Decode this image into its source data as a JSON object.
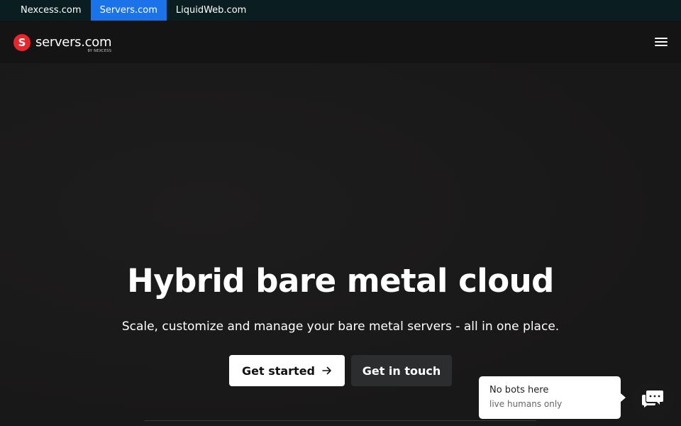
{
  "topbar": {
    "links": [
      {
        "label": "Nexcess.com"
      },
      {
        "label": "Servers.com"
      },
      {
        "label": "LiquidWeb.com"
      }
    ]
  },
  "header": {
    "logo_mark": "S",
    "logo_name": "servers.com",
    "logo_sub": "BY NEXCESS",
    "menu_icon": "hamburger-menu-icon"
  },
  "hero": {
    "title": "Hybrid bare metal cloud",
    "subtitle": "Scale, customize and manage your bare metal servers - all in one place.",
    "primary_button": "Get started",
    "primary_button_icon": "arrow-right-icon",
    "secondary_button": "Get in touch"
  },
  "chat": {
    "title": "No bots here",
    "subtitle": "live humans only",
    "icon": "chat-icon"
  },
  "colors": {
    "background": "#1a1919",
    "topbar": "#0a1e21",
    "active_link": "#1a73e8",
    "logo": "#e8242c"
  }
}
